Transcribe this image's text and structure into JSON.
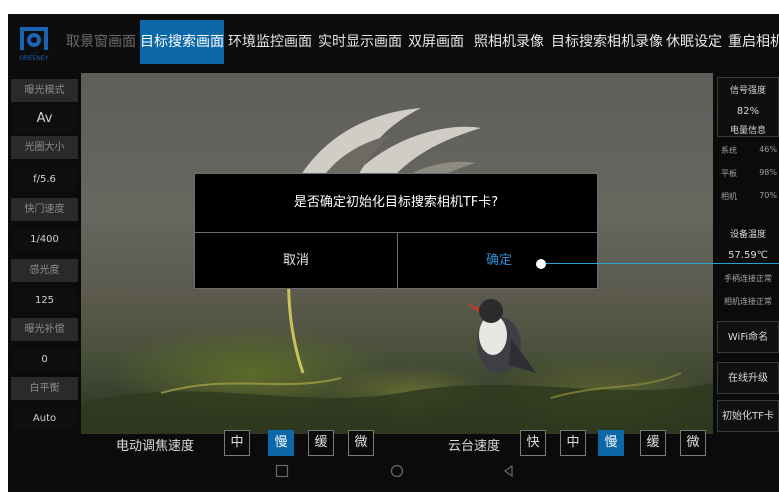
{
  "nav": {
    "tabs": [
      {
        "label": "取景窗画面",
        "active": false,
        "dim": true
      },
      {
        "label": "目标搜索画面",
        "active": true,
        "dim": false
      },
      {
        "label": "环境监控画面",
        "active": false,
        "dim": false
      },
      {
        "label": "实时显示画面",
        "active": false,
        "dim": false
      },
      {
        "label": "双屏画面",
        "active": false,
        "dim": false
      },
      {
        "label": "照相机录像",
        "active": false,
        "dim": false
      },
      {
        "label": "目标搜索相机录像",
        "active": false,
        "dim": false
      },
      {
        "label": "休眠设定",
        "active": false,
        "dim": false
      },
      {
        "label": "重启相机",
        "active": false,
        "dim": false
      }
    ]
  },
  "left_panel": [
    {
      "label": "曝光模式",
      "value": "Av"
    },
    {
      "label": "光圈大小",
      "value": "f/5.6"
    },
    {
      "label": "快门速度",
      "value": "1/400"
    },
    {
      "label": "感光度",
      "value": "125"
    },
    {
      "label": "曝光补偿",
      "value": "0"
    },
    {
      "label": "白平衡",
      "value": "Auto"
    }
  ],
  "right_panel": {
    "signal": {
      "title": "信号强度",
      "value": "82%"
    },
    "battery": {
      "title": "电量信息",
      "items": [
        {
          "label": "系统",
          "value": "46%"
        },
        {
          "label": "平板",
          "value": "98%"
        },
        {
          "label": "相机",
          "value": "70%"
        }
      ]
    },
    "temperature": {
      "title": "设备温度",
      "value": "57.59℃"
    },
    "status": [
      "手柄连接正常",
      "相机连接正常"
    ],
    "buttons": {
      "wifi": "WiFi命名",
      "upgrade": "在线升级",
      "init_tf": "初始化TF卡"
    }
  },
  "dialog": {
    "message": "是否确定初始化目标搜索相机TF卡?",
    "cancel": "取消",
    "confirm": "确定"
  },
  "focus_speed": {
    "label": "电动调焦速度",
    "options": [
      "中",
      "慢",
      "缓",
      "微"
    ],
    "selected": "慢"
  },
  "ptz_speed": {
    "label": "云台速度",
    "options": [
      "快",
      "中",
      "慢",
      "缓",
      "微"
    ],
    "selected": "慢"
  },
  "logo": {
    "text": "GREENEY"
  },
  "colors": {
    "accent": "#0c68a8",
    "callout": "#2a9fd9"
  }
}
